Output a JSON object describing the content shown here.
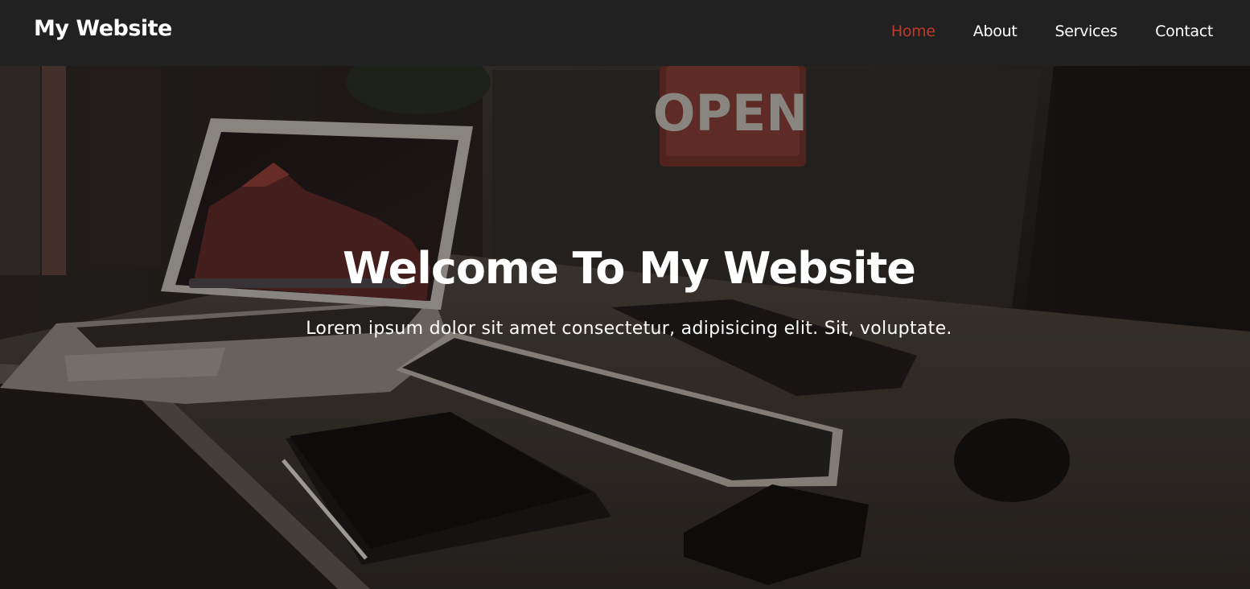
{
  "navbar": {
    "brand": "My Website",
    "links": [
      {
        "label": "Home",
        "active": true
      },
      {
        "label": "About",
        "active": false
      },
      {
        "label": "Services",
        "active": false
      },
      {
        "label": "Contact",
        "active": false
      }
    ],
    "active_color": "#c0392b",
    "background": "#212121"
  },
  "hero": {
    "title": "Welcome To My Website",
    "subtitle": "Lorem ipsum dolor sit amet consectetur, adipisicing elit. Sit, voluptate.",
    "sign_text": "OPEN",
    "background_image": "dark desk with laptop, keyboard, tablet, phone, mouse and open sign"
  }
}
